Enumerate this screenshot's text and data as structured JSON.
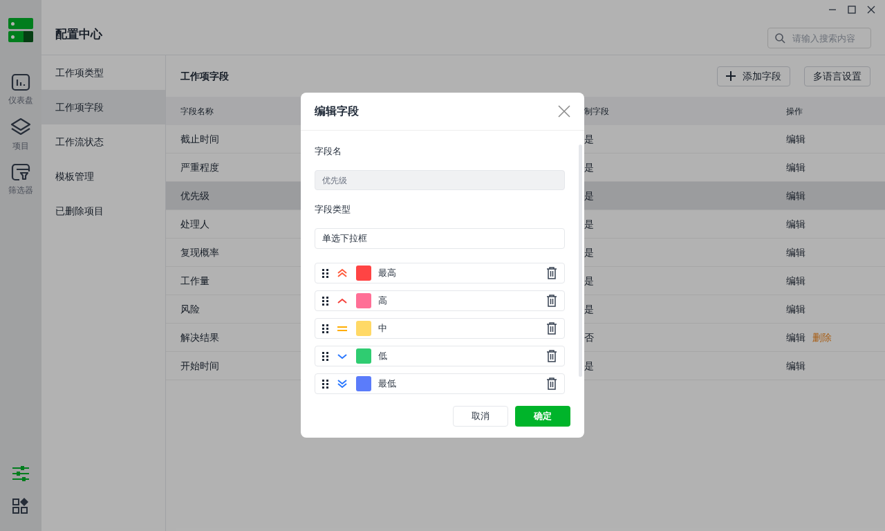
{
  "rail": {
    "items": [
      {
        "label": "仪表盘"
      },
      {
        "label": "项目"
      },
      {
        "label": "筛选器"
      }
    ],
    "bottom_icons": [
      {
        "selected": true
      },
      {
        "selected": false
      }
    ]
  },
  "header": {
    "title": "配置中心",
    "search": {
      "placeholder": "请输入搜索内容"
    }
  },
  "nav": {
    "items": [
      {
        "label": "工作项类型",
        "selected": false
      },
      {
        "label": "工作项字段",
        "selected": true
      },
      {
        "label": "工作流状态",
        "selected": false
      },
      {
        "label": "模板管理",
        "selected": false
      },
      {
        "label": "已删除项目",
        "selected": false
      }
    ]
  },
  "content": {
    "title": "工作项字段",
    "buttons": [
      {
        "label": "添加字段"
      },
      {
        "label": "多语言设置"
      }
    ],
    "table": {
      "columns": [
        "字段名称",
        "制字段",
        "操作"
      ],
      "rows": [
        {
          "name": "截止时间",
          "preset": "是",
          "actions": [
            "编辑"
          ],
          "selected": false
        },
        {
          "name": "严重程度",
          "preset": "是",
          "actions": [
            "编辑"
          ],
          "selected": false
        },
        {
          "name": "优先级",
          "preset": "是",
          "actions": [
            "编辑"
          ],
          "selected": true
        },
        {
          "name": "处理人",
          "preset": "是",
          "actions": [
            "编辑"
          ],
          "selected": false
        },
        {
          "name": "复现概率",
          "preset": "是",
          "actions": [
            "编辑"
          ],
          "selected": false
        },
        {
          "name": "工作量",
          "preset": "是",
          "actions": [
            "编辑"
          ],
          "selected": false
        },
        {
          "name": "风险",
          "preset": "是",
          "actions": [
            "编辑"
          ],
          "selected": false
        },
        {
          "name": "解决结果",
          "preset": "否",
          "actions": [
            "编辑",
            "删除"
          ],
          "selected": false
        },
        {
          "name": "开始时间",
          "preset": "是",
          "actions": [
            "编辑"
          ],
          "selected": false
        }
      ]
    }
  },
  "dialog": {
    "title": "编辑字段",
    "name_label": "字段名",
    "name_value": "优先级",
    "type_label": "字段类型",
    "type_value": "单选下拉框",
    "options": [
      {
        "label": "最高",
        "kind": "double-up",
        "color": "#ff4444"
      },
      {
        "label": "高",
        "kind": "up",
        "color": "#ff6f96"
      },
      {
        "label": "中",
        "kind": "equal",
        "color": "#ffd966"
      },
      {
        "label": "低",
        "kind": "down",
        "color": "#2fcc71"
      },
      {
        "label": "最低",
        "kind": "double-down",
        "color": "#5b7cfa"
      }
    ],
    "buttons": [
      {
        "label": "取消",
        "primary": false
      },
      {
        "label": "确定",
        "primary": true
      }
    ]
  }
}
